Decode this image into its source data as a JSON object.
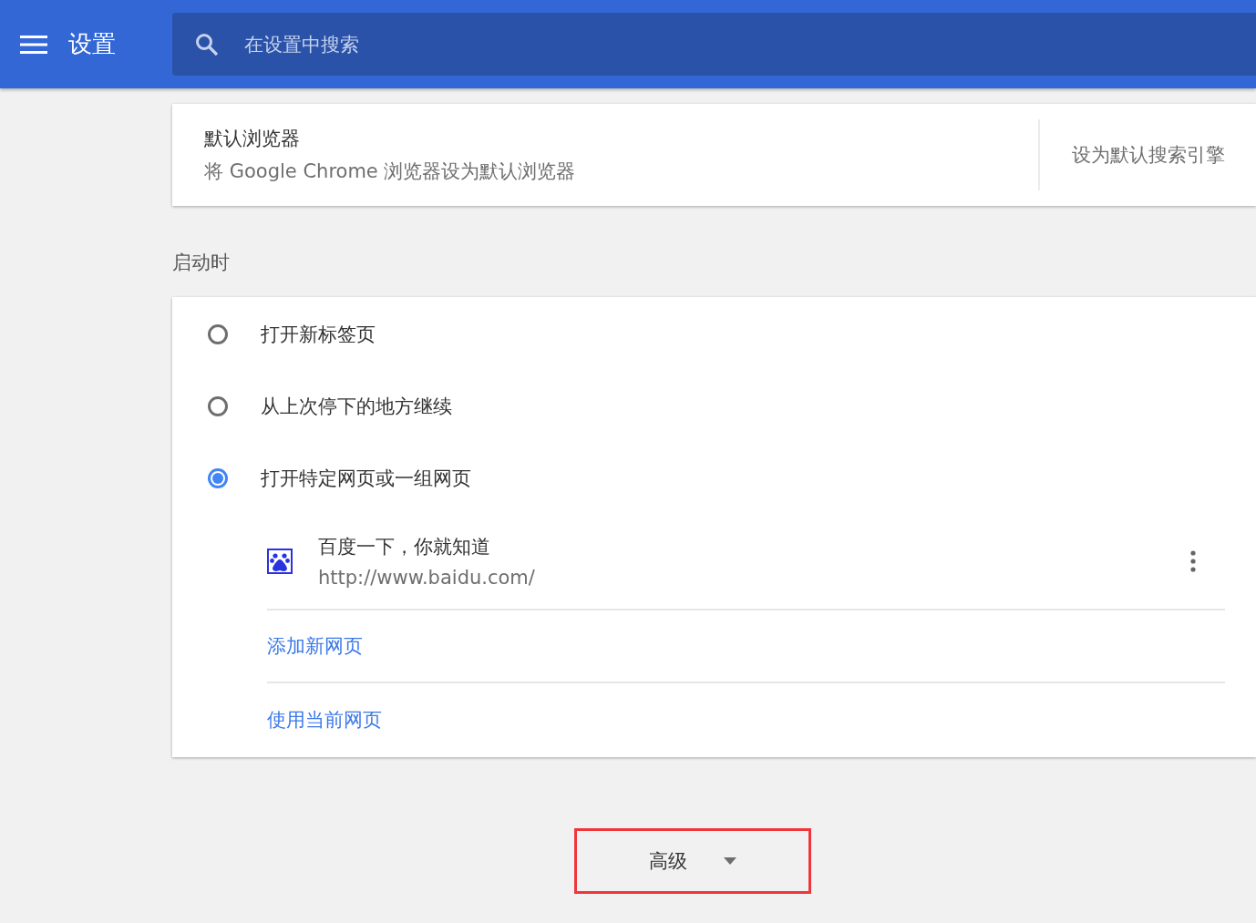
{
  "header": {
    "title": "设置",
    "search": {
      "placeholder": "在设置中搜索"
    }
  },
  "default_browser": {
    "title": "默认浏览器",
    "subtitle": "将 Google Chrome 浏览器设为默认浏览器",
    "action": "设为默认搜索引擎"
  },
  "startup": {
    "heading": "启动时",
    "options": [
      {
        "label": "打开新标签页",
        "selected": false
      },
      {
        "label": "从上次停下的地方继续",
        "selected": false
      },
      {
        "label": "打开特定网页或一组网页",
        "selected": true
      }
    ],
    "pages": [
      {
        "title": "百度一下，你就知道",
        "url": "http://www.baidu.com/"
      }
    ],
    "links": [
      "添加新网页",
      "使用当前网页"
    ]
  },
  "advanced": {
    "label": "高级",
    "highlighted": true
  }
}
